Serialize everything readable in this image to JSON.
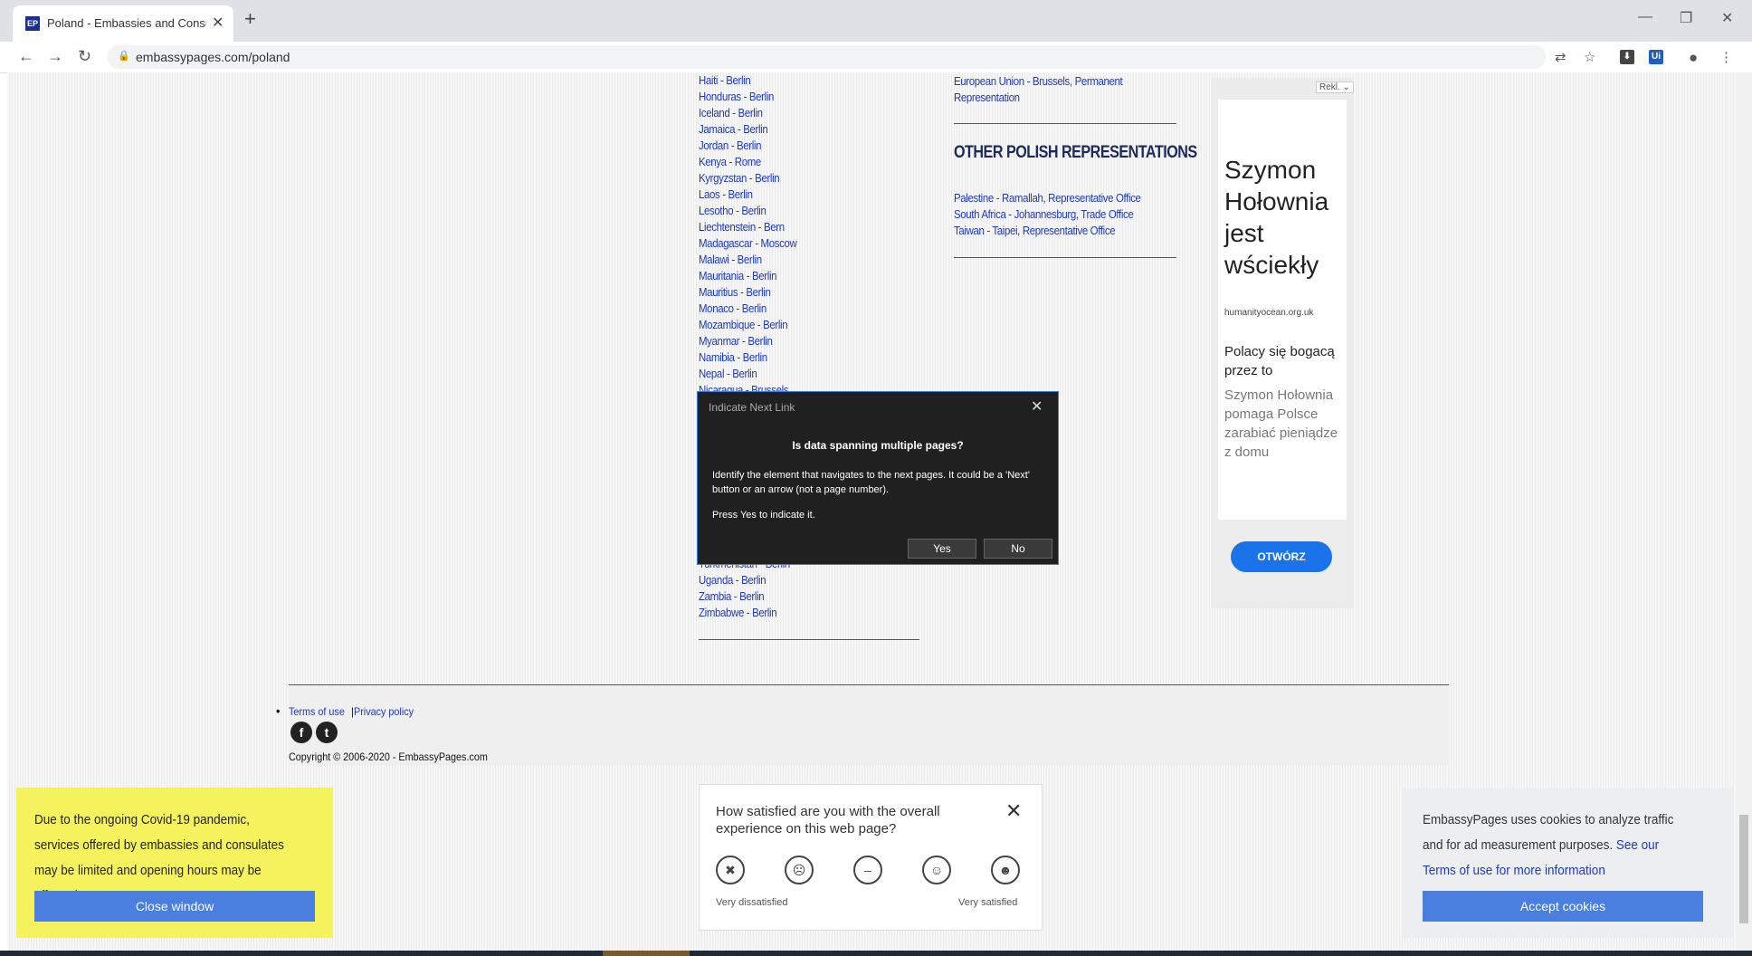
{
  "browser": {
    "tab_title": "Poland - Embassies and Consulat",
    "favicon_text": "EP",
    "url": "embassypages.com/poland"
  },
  "embassies_top": [
    "Haiti - Berlin",
    "Honduras - Berlin",
    "Iceland - Berlin",
    "Jamaica - Berlin",
    "Jordan - Berlin",
    "Kenya - Rome",
    "Kyrgyzstan - Berlin",
    "Laos - Berlin",
    "Lesotho - Berlin",
    "Liechtenstein - Bern",
    "Madagascar - Moscow",
    "Malawi - Berlin",
    "Mauritania - Berlin",
    "Mauritius - Berlin",
    "Monaco - Berlin",
    "Mozambique - Berlin",
    "Myanmar - Berlin",
    "Namibia - Berlin",
    "Nepal - Berlin",
    "Nicaragua - Brussels"
  ],
  "embassies_bottom": [
    "Turkmenistan - Berlin",
    "Uganda - Berlin",
    "Zambia - Berlin",
    "Zimbabwe - Berlin"
  ],
  "eu_link": "European Union - Brussels, Permanent Representation",
  "other_heading": "OTHER POLISH REPRESENTATIONS",
  "other_reps": [
    "Palestine - Ramallah, Representative Office",
    "South Africa - Johannesburg, Trade Office",
    "Taiwan - Taipei, Representative Office"
  ],
  "ad": {
    "label": "Rekl.",
    "headline": "Szymon Hołownia jest wściekły",
    "domain": "humanityocean.org.uk",
    "subheadline": "Polacy się bogacą przez to",
    "body": "Szymon Hołownia pomaga Polsce zarabiać pieniądze z domu",
    "cta": "OTWÓRZ"
  },
  "footer": {
    "terms": "Terms of use",
    "separator": " | ",
    "privacy": "Privacy policy",
    "copyright": "Copyright © 2006-2020 - EmbassyPages.com"
  },
  "modal": {
    "title": "Indicate Next Link",
    "question": "Is data spanning multiple pages?",
    "description": "Identify the element that navigates to the next pages. It could be a 'Next' button or an arrow (not a page number).",
    "press": "Press Yes to indicate it.",
    "yes": "Yes",
    "no": "No"
  },
  "covid": {
    "text": "Due to the ongoing Covid-19 pandemic, services offered by embassies and consulates may be limited and opening hours may be affected",
    "button": "Close window"
  },
  "survey": {
    "question": "How satisfied are you with the overall experience on this web page?",
    "low_label": "Very dissatisfied",
    "high_label": "Very satisfied"
  },
  "cookie": {
    "text": "EmbassyPages uses cookies to analyze traffic and for ad measurement purposes.",
    "link": "See our Terms of use for more information",
    "button": "Accept cookies"
  },
  "colors": {
    "link": "#1f3bb8",
    "covid_bg": "#f4f35e",
    "button_blue": "#4a7fe0",
    "modal_bg": "#202020"
  }
}
